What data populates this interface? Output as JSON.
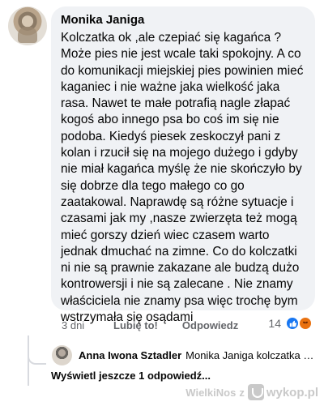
{
  "comment": {
    "author": "Monika Janiga",
    "text": "Kolczatka ok ,ale czepiać się kagańca ? Może pies nie jest wcale taki spokojny. A co do komunikacji miejskiej pies powinien mieć kaganiec i nie ważne jaka wielkość jaka rasa. Nawet te małe potrafią nagle złapać kogoś abo innego psa  bo coś im się nie podoba. Kiedyś piesek zeskoczył pani  z kolan i rzucił się na mojego dużego i gdyby nie miał kagańca myślę że nie skończyło by się dobrze dla tego małego co go zaatakowal. Naprawdę są różne sytuacje i czasami jak my ,nasze zwierzęta też mogą mieć gorszy dzień wiec czasem warto jednak dmuchać na zimne. Co do kolczatki ni nie są prawnie zakazane ale budzą dużo kontrowersji i nie są zalecane . Nie znamy właściciela nie znamy psa więc trochę bym wstrzymała się osądami",
    "time": "3 dni",
    "like_label": "Lubię to!",
    "reply_label": "Odpowiedz",
    "reaction_count": "14"
  },
  "reply": {
    "author": "Anna Iwona Sztadler",
    "preview": "Monika Janiga kolczatka ok..."
  },
  "more_replies": "Wyświetl jeszcze 1 odpowiedź...",
  "watermark": {
    "source": "WielkiNos",
    "separator": "z",
    "site": "wykop.pl"
  },
  "icons": {
    "like": "like-icon",
    "angry": "angry-icon",
    "wykop": "wykop-logo-icon"
  },
  "colors": {
    "bubble": "#f0f2f5",
    "secondary_text": "#65676b",
    "like_blue": "#1877f2",
    "angry_orange": "#e9710f"
  }
}
